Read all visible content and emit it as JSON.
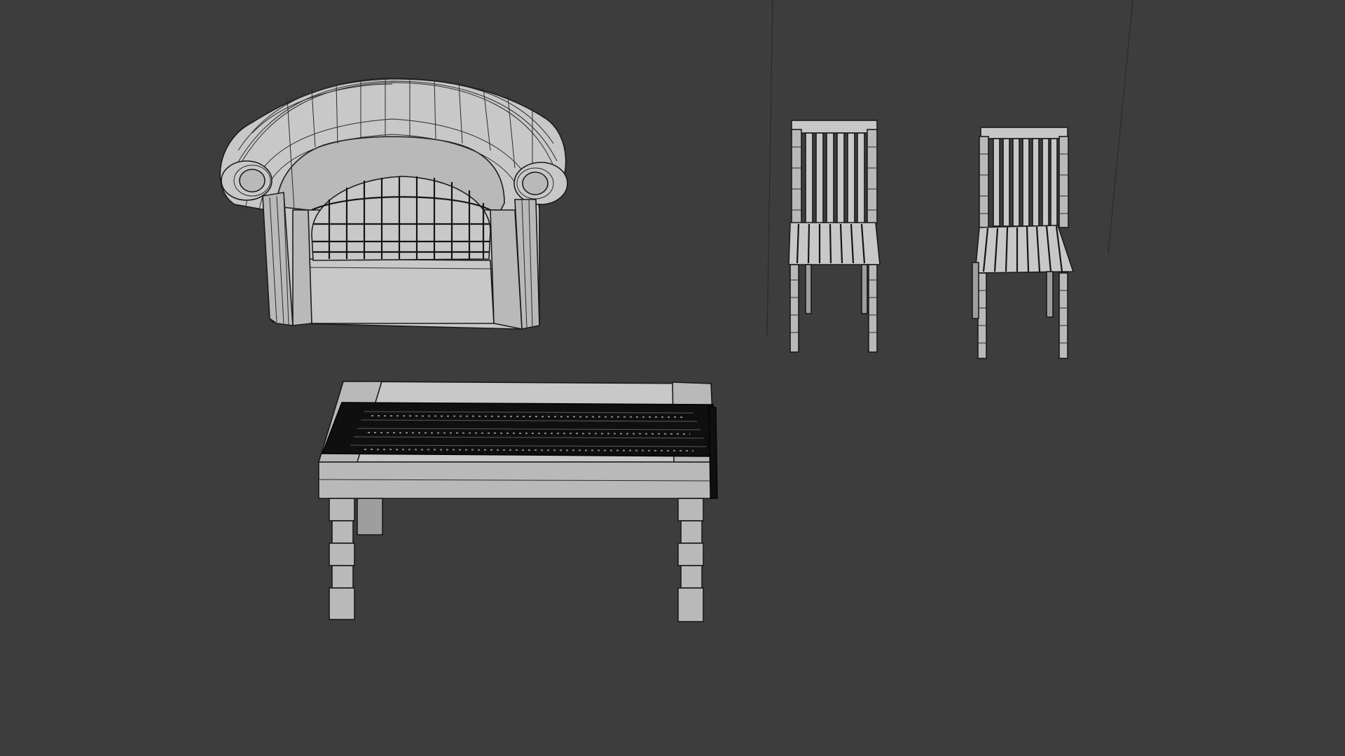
{
  "viewport": {
    "background": "#3d3d3d",
    "shading": "solid-with-wireframe",
    "mesh_color": "#b9b9b9",
    "edge_color": "#1a1a1a"
  },
  "objects": [
    {
      "name": "armchair",
      "icon": "armchair-mesh"
    },
    {
      "name": "chair-left",
      "icon": "chair-mesh"
    },
    {
      "name": "chair-right",
      "icon": "chair-mesh"
    },
    {
      "name": "coffee-table",
      "icon": "table-mesh"
    },
    {
      "name": "table-runner",
      "icon": "cloth-mesh"
    }
  ]
}
